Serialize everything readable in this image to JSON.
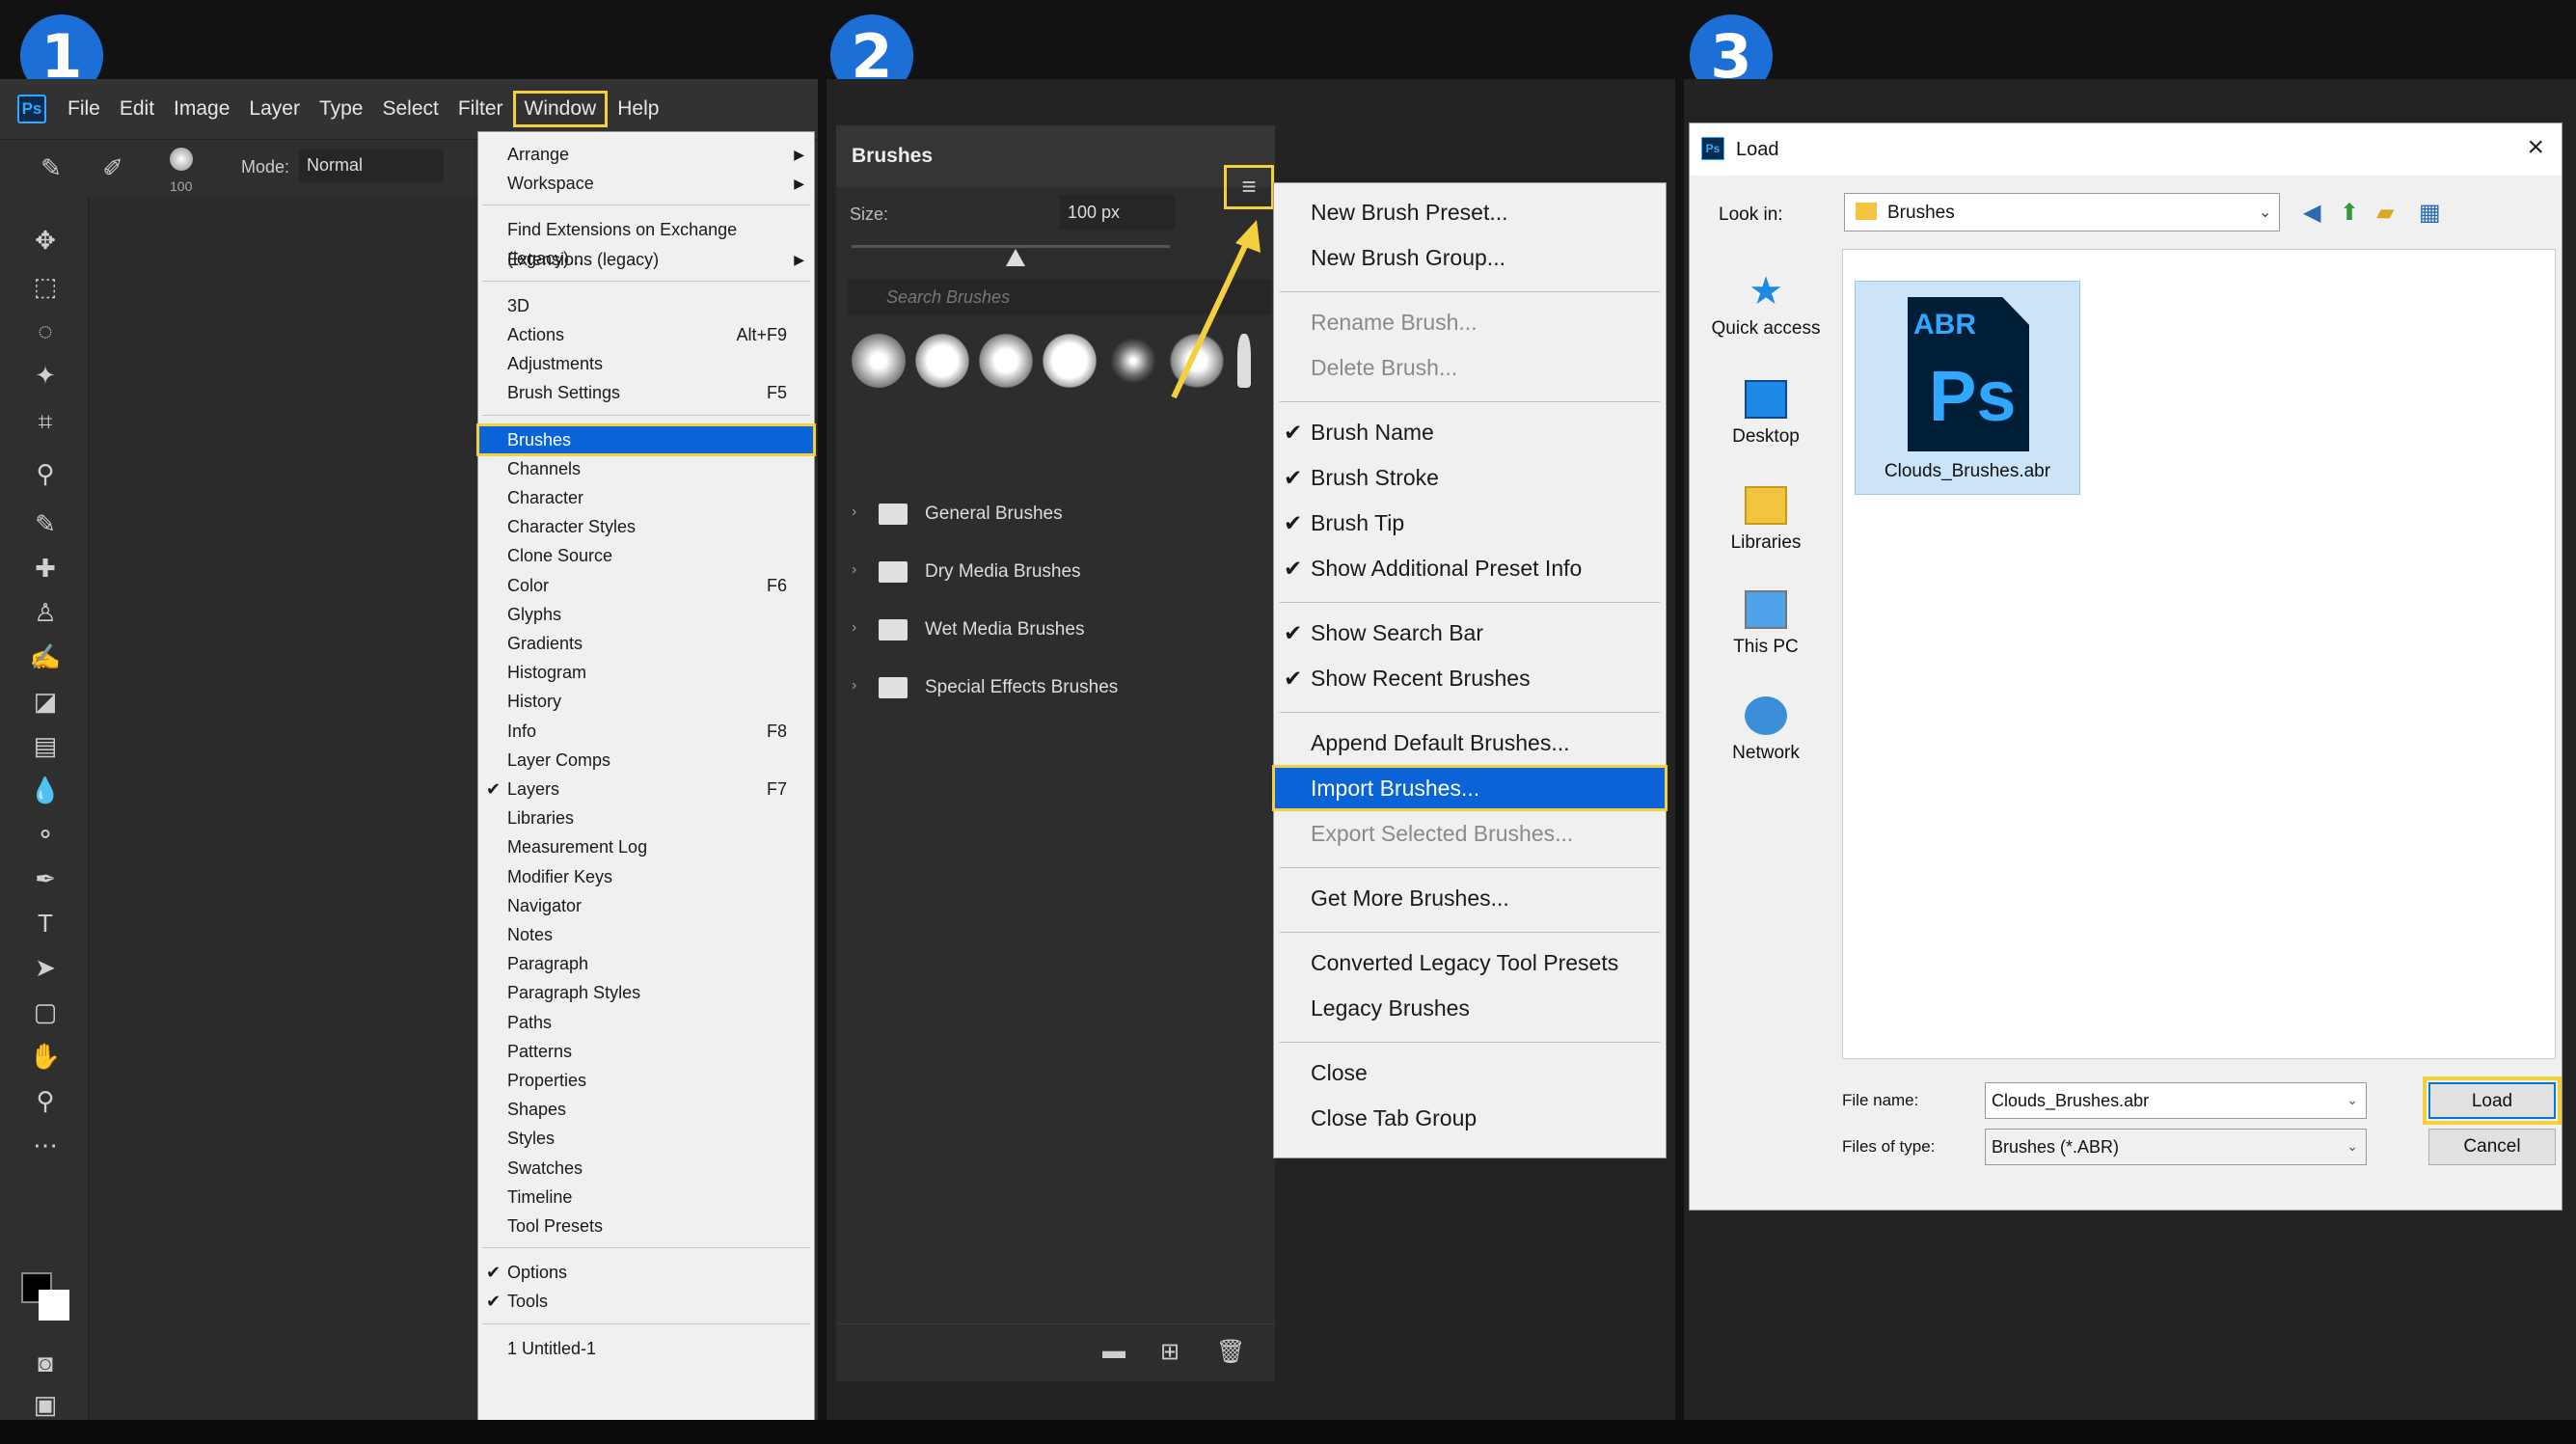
{
  "steps": [
    "1",
    "2",
    "3"
  ],
  "app_menu": {
    "logo": "Ps",
    "items": [
      "File",
      "Edit",
      "Image",
      "Layer",
      "Type",
      "Select",
      "Filter",
      "Window",
      "Help"
    ]
  },
  "options_bar": {
    "brush_size": "100",
    "mode_label": "Mode:",
    "mode_value": "Normal"
  },
  "window_menu": {
    "groups": [
      [
        {
          "label": "Arrange",
          "submenu": true
        },
        {
          "label": "Workspace",
          "submenu": true
        }
      ],
      [
        {
          "label": "Find Extensions on Exchange (legacy)..."
        },
        {
          "label": "Extensions (legacy)",
          "submenu": true
        }
      ],
      [
        {
          "label": "3D"
        },
        {
          "label": "Actions",
          "shortcut": "Alt+F9"
        },
        {
          "label": "Adjustments"
        },
        {
          "label": "Brush Settings",
          "shortcut": "F5"
        }
      ],
      [
        {
          "label": "Brushes",
          "selected": true
        },
        {
          "label": "Channels"
        },
        {
          "label": "Character"
        },
        {
          "label": "Character Styles"
        },
        {
          "label": "Clone Source"
        },
        {
          "label": "Color",
          "shortcut": "F6"
        },
        {
          "label": "Glyphs"
        },
        {
          "label": "Gradients"
        },
        {
          "label": "Histogram"
        },
        {
          "label": "History"
        },
        {
          "label": "Info",
          "shortcut": "F8"
        },
        {
          "label": "Layer Comps"
        },
        {
          "label": "Layers",
          "shortcut": "F7",
          "checked": true
        },
        {
          "label": "Libraries"
        },
        {
          "label": "Measurement Log"
        },
        {
          "label": "Modifier Keys"
        },
        {
          "label": "Navigator"
        },
        {
          "label": "Notes"
        },
        {
          "label": "Paragraph"
        },
        {
          "label": "Paragraph Styles"
        },
        {
          "label": "Paths"
        },
        {
          "label": "Patterns"
        },
        {
          "label": "Properties"
        },
        {
          "label": "Shapes"
        },
        {
          "label": "Styles"
        },
        {
          "label": "Swatches"
        },
        {
          "label": "Timeline"
        },
        {
          "label": "Tool Presets"
        }
      ],
      [
        {
          "label": "Options",
          "checked": true
        },
        {
          "label": "Tools",
          "checked": true
        }
      ],
      [
        {
          "label": "1 Untitled-1"
        }
      ]
    ]
  },
  "brushes_panel": {
    "title": "Brushes",
    "size_label": "Size:",
    "size_value": "100 px",
    "search_placeholder": "Search Brushes",
    "folders": [
      "General Brushes",
      "Dry Media Brushes",
      "Wet Media Brushes",
      "Special Effects Brushes"
    ]
  },
  "brush_menu": {
    "groups": [
      [
        {
          "label": "New Brush Preset..."
        },
        {
          "label": "New Brush Group..."
        }
      ],
      [
        {
          "label": "Rename Brush...",
          "disabled": true
        },
        {
          "label": "Delete Brush...",
          "disabled": true
        }
      ],
      [
        {
          "label": "Brush Name",
          "checked": true
        },
        {
          "label": "Brush Stroke",
          "checked": true
        },
        {
          "label": "Brush Tip",
          "checked": true
        },
        {
          "label": "Show Additional Preset Info",
          "checked": true
        }
      ],
      [
        {
          "label": "Show Search Bar",
          "checked": true
        },
        {
          "label": "Show Recent Brushes",
          "checked": true
        }
      ],
      [
        {
          "label": "Append Default Brushes..."
        },
        {
          "label": "Import Brushes...",
          "selected": true
        },
        {
          "label": "Export Selected Brushes...",
          "disabled": true
        }
      ],
      [
        {
          "label": "Get More Brushes..."
        }
      ],
      [
        {
          "label": "Converted Legacy Tool Presets"
        },
        {
          "label": "Legacy Brushes"
        }
      ],
      [
        {
          "label": "Close"
        },
        {
          "label": "Close Tab Group"
        }
      ]
    ]
  },
  "load_dialog": {
    "title": "Load",
    "logo": "Ps",
    "look_in_label": "Look in:",
    "look_in_value": "Brushes",
    "places": [
      "Quick access",
      "Desktop",
      "Libraries",
      "This PC",
      "Network"
    ],
    "file": {
      "name": "Clouds_Brushes.abr",
      "badge": "ABR",
      "logo": "Ps"
    },
    "file_name_label": "File name:",
    "file_name_value": "Clouds_Brushes.abr",
    "file_type_label": "Files of type:",
    "file_type_value": "Brushes (*.ABR)",
    "load_button": "Load",
    "cancel_button": "Cancel"
  },
  "colors": {
    "highlight": "#f4d03f",
    "selection": "#0b63d8",
    "badge": "#1b6fd6"
  }
}
